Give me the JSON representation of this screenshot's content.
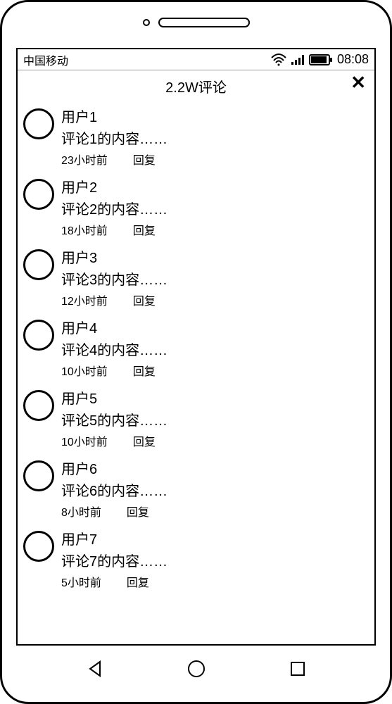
{
  "statusBar": {
    "carrier": "中国移动",
    "time": "08:08"
  },
  "header": {
    "title": "2.2W评论",
    "closeLabel": "✕"
  },
  "comments": [
    {
      "username": "用户1",
      "content": "评论1的内容……",
      "time": "23小时前",
      "reply": "回复"
    },
    {
      "username": "用户2",
      "content": "评论2的内容……",
      "time": "18小时前",
      "reply": "回复"
    },
    {
      "username": "用户3",
      "content": "评论3的内容……",
      "time": "12小时前",
      "reply": "回复"
    },
    {
      "username": "用户4",
      "content": "评论4的内容……",
      "time": "10小时前",
      "reply": "回复"
    },
    {
      "username": "用户5",
      "content": "评论5的内容……",
      "time": "10小时前",
      "reply": "回复"
    },
    {
      "username": "用户6",
      "content": "评论6的内容……",
      "time": "8小时前",
      "reply": "回复"
    },
    {
      "username": "用户7",
      "content": "评论7的内容……",
      "time": "5小时前",
      "reply": "回复"
    }
  ]
}
